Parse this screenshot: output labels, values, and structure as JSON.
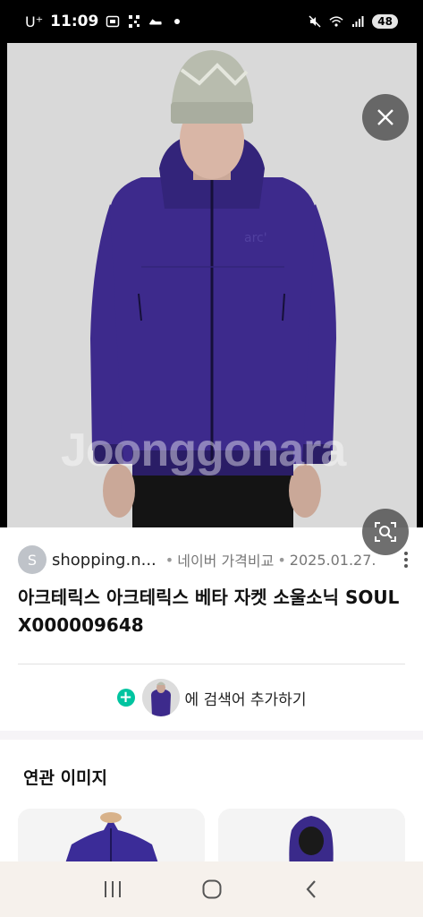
{
  "status_bar": {
    "carrier": "U⁺",
    "time": "11:09",
    "battery": "48"
  },
  "hero": {
    "watermark": "Joonggonara",
    "close_label": "close",
    "lens_label": "image search"
  },
  "source": {
    "avatar_letter": "S",
    "name": "shopping.n...",
    "separator": "•",
    "provider": "네이버 가격비교",
    "date": "2025.01.27."
  },
  "product": {
    "title": "아크테릭스 아크테릭스 베타 자켓 소울소닉 SOUL X000009648"
  },
  "add_search": {
    "label": "에 검색어 추가하기"
  },
  "related": {
    "title": "연관 이미지"
  },
  "colors": {
    "jacket": "#3d2a8c",
    "accent_green": "#00c4a0",
    "background_gray": "#d9d9d9"
  }
}
